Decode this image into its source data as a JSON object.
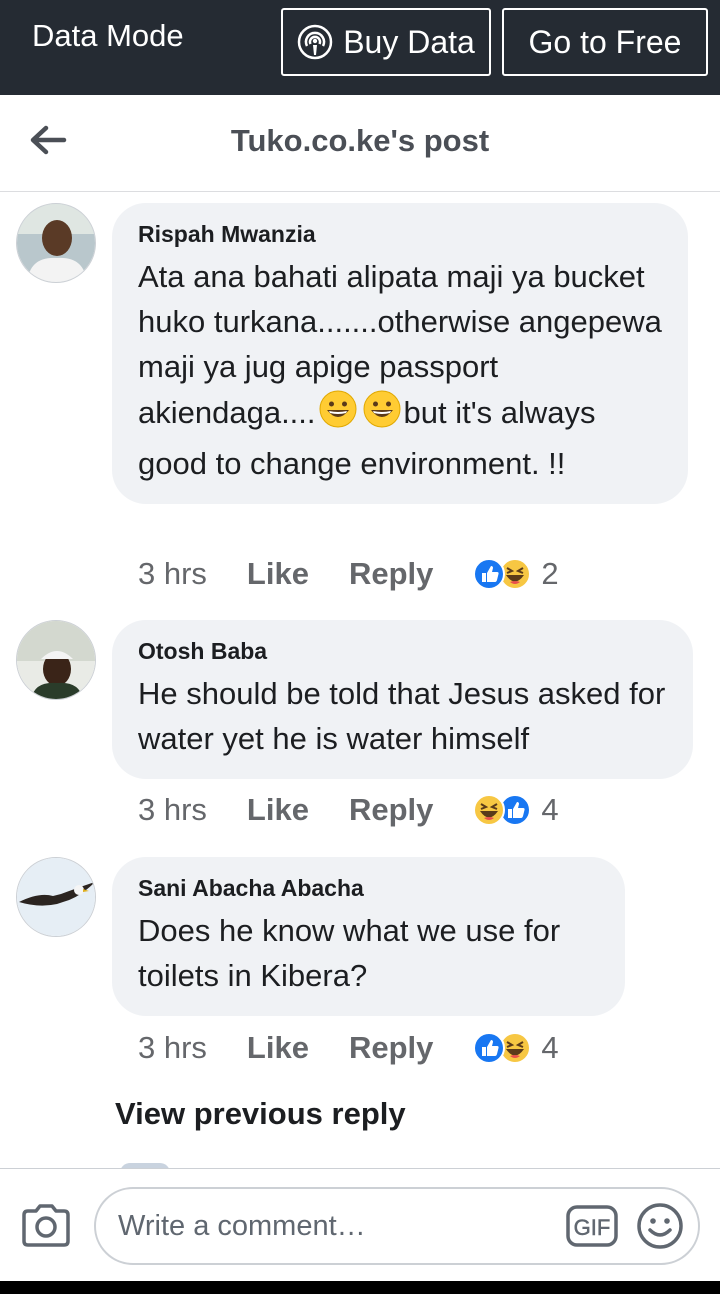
{
  "topbar": {
    "data_mode": "Data Mode",
    "buy_data": "Buy Data",
    "go_to_free": "Go to Free"
  },
  "header": {
    "title": "Tuko.co.ke's post"
  },
  "comments": [
    {
      "author": "Rispah Mwanzia",
      "text_before": "Ata ana bahati alipata maji ya bucket huko turkana.......otherwise angepewa maji ya jug apige passport akiendaga....",
      "emoji": "grinning-face",
      "text_after": "but it's always good to change environment. !!",
      "time": "3 hrs",
      "like": "Like",
      "reply": "Reply",
      "reactions": [
        "like",
        "haha"
      ],
      "reaction_count": "2"
    },
    {
      "author": "Otosh Baba",
      "text": "He should be told that Jesus asked for water yet he is water himself",
      "time": "3 hrs",
      "like": "Like",
      "reply": "Reply",
      "reactions": [
        "haha",
        "like"
      ],
      "reaction_count": "4"
    },
    {
      "author": "Sani Abacha Abacha",
      "text": "Does he know what we use for toilets in Kibera?",
      "time": "3 hrs",
      "like": "Like",
      "reply": "Reply",
      "reactions": [
        "like",
        "haha"
      ],
      "reaction_count": "4"
    }
  ],
  "view_previous": "View previous reply",
  "composer": {
    "placeholder": "Write a comment…"
  },
  "colors": {
    "topbar": "#252b33",
    "bubble": "#f0f2f5",
    "like_blue": "#1877f2",
    "haha_yellow": "#f7c743"
  }
}
